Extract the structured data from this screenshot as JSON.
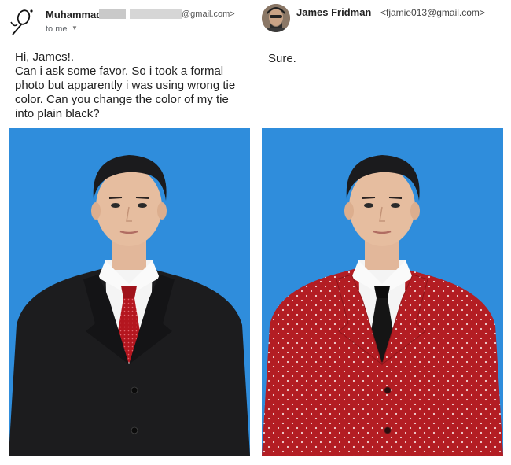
{
  "original_email": {
    "sender_name": "Muhammad",
    "sender_email_suffix": "@gmail.com>",
    "recipient_label": "to me",
    "body_lines": [
      "Hi, James!.",
      "Can i ask some favor. So i took a formal",
      "photo but apparently i was using wrong tie",
      "color. Can you change the color of my tie",
      "into plain black?"
    ]
  },
  "reply_email": {
    "sender_name": "James Fridman",
    "sender_email": "<fjamie013@gmail.com>",
    "body": "Sure."
  },
  "photos": {
    "background_color": "#2f8ddc",
    "original": {
      "suit_color": "#1c1c1e",
      "tie_color": "#b4161f",
      "tie_pattern": "dotted"
    },
    "edited": {
      "suit_color": "#b31d23",
      "suit_pattern": "white-dots",
      "tie_color": "#151515"
    }
  }
}
